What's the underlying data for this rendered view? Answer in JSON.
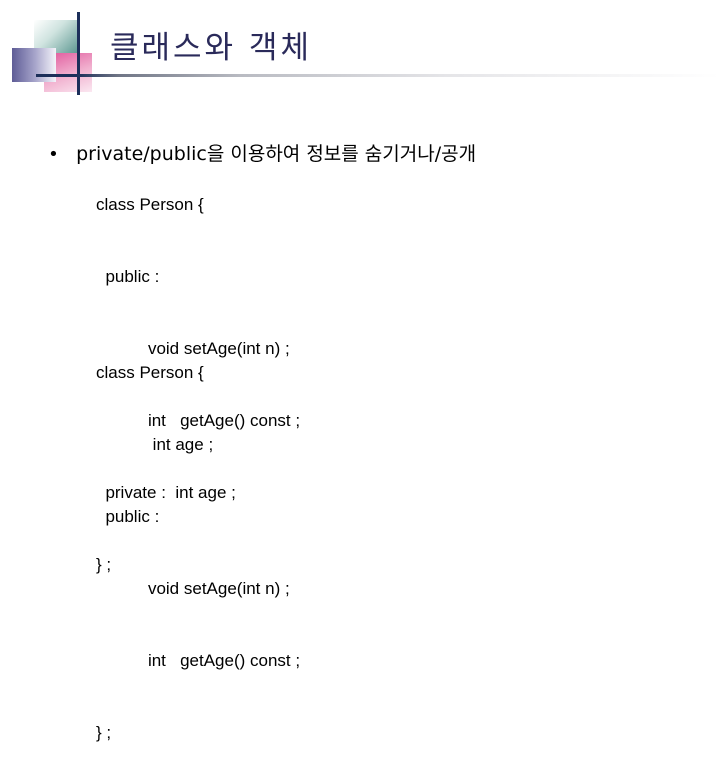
{
  "slide": {
    "title": "클래스와 객체",
    "bullet": {
      "marker": "•",
      "text": "private/public을 이용하여 정보를 숨기거나/공개"
    },
    "code_blocks": [
      {
        "lines": [
          "class Person {",
          "  public :",
          "           void setAge(int n) ;",
          "           int   getAge() const ;",
          "  private :  int age ;",
          "} ;"
        ]
      },
      {
        "lines": [
          "class Person {",
          "            int age ;",
          "  public :",
          "           void setAge(int n) ;",
          "           int   getAge() const ;",
          "} ;"
        ]
      }
    ]
  },
  "colors": {
    "title_text": "#2a2a5a",
    "accent_line": "#1c2f5a",
    "teal": "#4f8f88",
    "pink": "#e0569b",
    "purple": "#5e5c96"
  }
}
